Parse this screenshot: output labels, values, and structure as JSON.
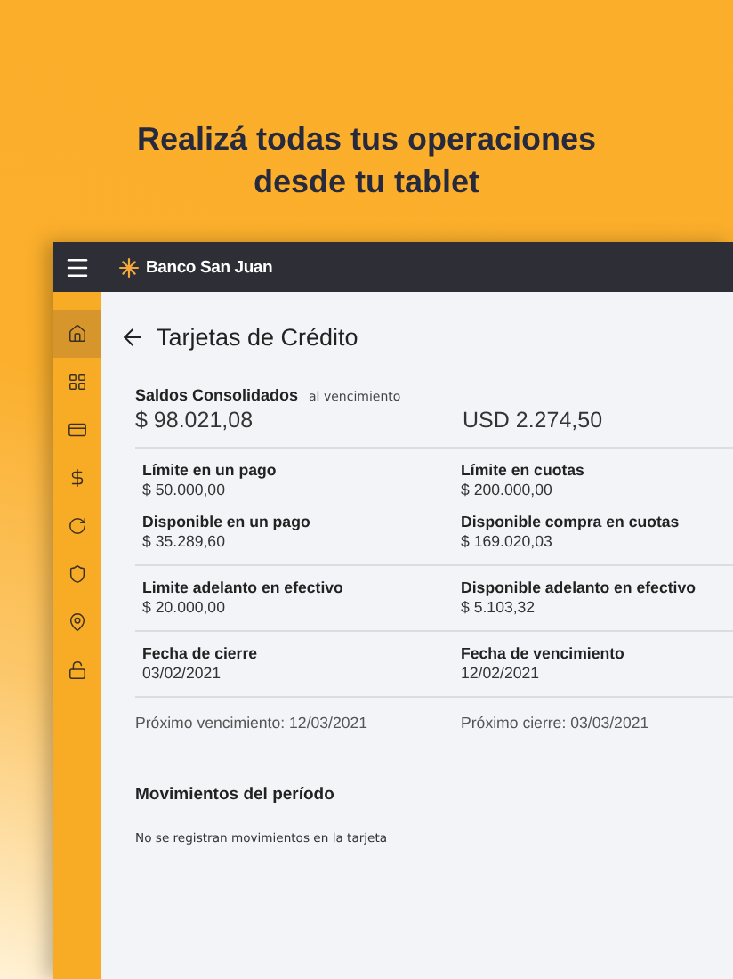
{
  "headline": "Realizá todas tus operaciones desde tu tablet",
  "app_bar": {
    "brand": "Banco San Juan"
  },
  "sidebar": {
    "items": [
      {
        "kind": "home",
        "selected": true
      },
      {
        "kind": "apps",
        "selected": false
      },
      {
        "kind": "card",
        "selected": false
      },
      {
        "kind": "exchange",
        "selected": false
      },
      {
        "kind": "refresh",
        "selected": false
      },
      {
        "kind": "shield",
        "selected": false
      },
      {
        "kind": "location",
        "selected": false
      },
      {
        "kind": "lock",
        "selected": false
      }
    ]
  },
  "page": {
    "title": "Tarjetas de Crédito",
    "balances": {
      "label": "Saldos Consolidados",
      "note": "al vencimiento",
      "pesos": "$ 98.021,08",
      "dollars": "USD 2.274,50"
    },
    "sections": [
      {
        "fields": [
          {
            "label": "Límite en un pago",
            "value": "$ 50.000,00"
          },
          {
            "label": "Límite en cuotas",
            "value": "$ 200.000,00"
          },
          {
            "label": "Disponible en un pago",
            "value": "$ 35.289,60"
          },
          {
            "label": "Disponible compra en cuotas",
            "value": "$ 169.020,03"
          }
        ]
      },
      {
        "fields": [
          {
            "label": "Limite adelanto en efectivo",
            "value": "$ 20.000,00"
          },
          {
            "label": "Disponible adelanto en efectivo",
            "value": "$ 5.103,32"
          }
        ]
      },
      {
        "fields": [
          {
            "label": "Fecha de cierre",
            "value": "03/02/2021"
          },
          {
            "label": "Fecha de vencimiento",
            "value": "12/02/2021"
          }
        ]
      }
    ],
    "next_due": "Próximo vencimiento: 12/03/2021",
    "next_close": "Próximo cierre: 03/03/2021",
    "movements": {
      "title": "Movimientos del período",
      "empty": "No se registran movimientos en la tarjeta"
    }
  }
}
